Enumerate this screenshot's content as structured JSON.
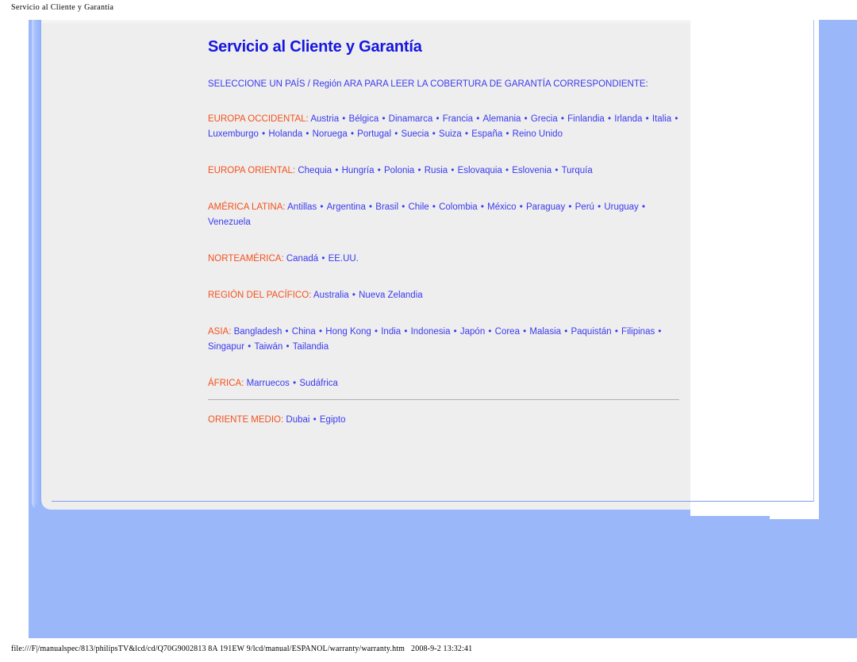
{
  "browser_chrome": {
    "header_title": "Servicio al Cliente y Garantía",
    "footer_path": "file:///F|/manualspec/813/philipsTV&lcd/cd/Q70G9002813 8A  191EW 9/lcd/manual/ESPANOL/warranty/warranty.htm",
    "footer_timestamp": "2008-9-2 13:32:41"
  },
  "colors": {
    "page_background": "#9ab7fa",
    "panel_background": "#eeeeee",
    "heading": "#1616e0",
    "link": "#3a3af0",
    "region_label": "#f4511e",
    "divider": "#b0b0b0",
    "rail_blue": "#8fb0f8"
  },
  "main": {
    "title": "Servicio al Cliente y Garantía",
    "intro": "SELECCIONE UN PAÍS / Región ARA PARA LEER LA COBERTURA DE GARANTÍA CORRESPONDIENTE:",
    "regions": [
      {
        "label": "EUROPA OCCIDENTAL:",
        "countries": [
          "Austria",
          "Bélgica",
          "Dinamarca",
          "Francia",
          "Alemania",
          "Grecia",
          "Finlandia",
          "Irlanda",
          "Italia",
          "Luxemburgo",
          "Holanda",
          "Noruega",
          "Portugal",
          "Suecia",
          "Suiza",
          "España",
          "Reino Unido"
        ]
      },
      {
        "label": "EUROPA ORIENTAL:",
        "countries": [
          "Chequia",
          "Hungría",
          "Polonia",
          "Rusia",
          "Eslovaquia",
          "Eslovenia",
          "Turquía"
        ]
      },
      {
        "label": "AMÉRICA LATINA:",
        "countries": [
          "Antillas",
          "Argentina",
          "Brasil",
          "Chile",
          "Colombia",
          "México",
          "Paraguay",
          "Perú",
          "Uruguay",
          "Venezuela"
        ]
      },
      {
        "label": "NORTEAMÉRICA:",
        "countries": [
          "Canadá",
          "EE.UU."
        ]
      },
      {
        "label": "REGIÓN DEL PACÍFICO:",
        "countries": [
          "Australia",
          "Nueva Zelandia"
        ]
      },
      {
        "label": "ASIA:",
        "countries": [
          "Bangladesh",
          "China",
          "Hong Kong",
          "India",
          "Indonesia",
          "Japón",
          "Corea",
          "Malasia",
          "Paquistán",
          "Filipinas",
          "Singapur",
          "Taiwán",
          "Tailandia"
        ]
      },
      {
        "label": "ÁFRICA:",
        "countries": [
          "Marruecos",
          "Sudáfrica"
        ]
      },
      {
        "label": "ORIENTE MEDIO:",
        "countries": [
          "Dubai",
          "Egipto"
        ]
      }
    ],
    "separator": "•"
  }
}
